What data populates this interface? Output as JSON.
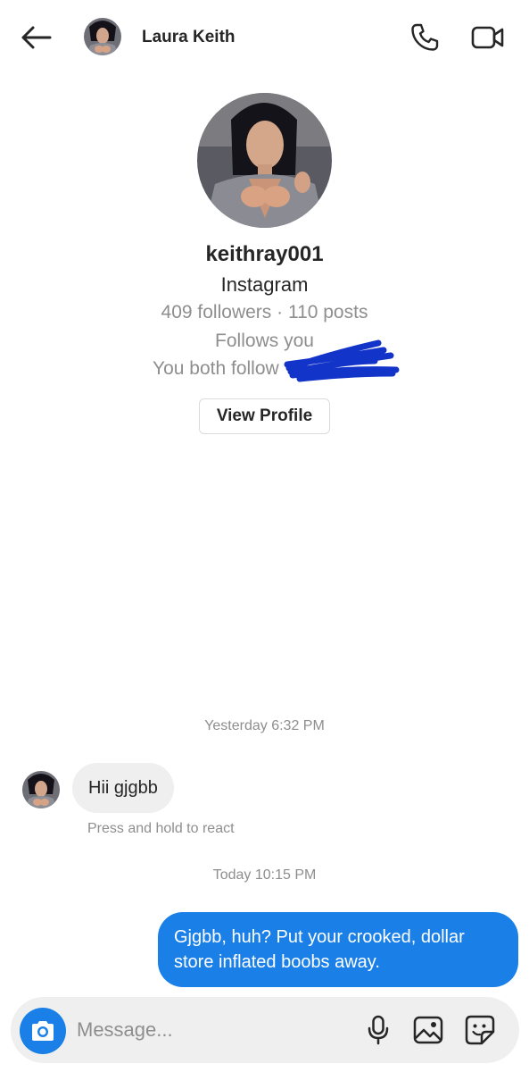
{
  "header": {
    "contact_name": "Laura Keith",
    "back_icon": "arrow-left-icon",
    "call_icon": "phone-icon",
    "video_icon": "video-camera-icon"
  },
  "profile": {
    "username": "keithray001",
    "platform": "Instagram",
    "stats": "409 followers · 110 posts",
    "follows_status": "Follows you",
    "mutual_prefix": "You both follow",
    "view_profile_label": "View Profile"
  },
  "messages": {
    "timestamp_1": "Yesterday 6:32 PM",
    "incoming_text": "Hii gjgbb",
    "react_hint": "Press and hold to react",
    "timestamp_2": "Today 10:15 PM",
    "outgoing_line_1": "Gjgbb, huh? Put your crooked, dollar",
    "outgoing_line_2": "store inflated boobs away."
  },
  "composer": {
    "placeholder": "Message...",
    "camera_icon": "camera-icon",
    "mic_icon": "microphone-icon",
    "gallery_icon": "image-gallery-icon",
    "sticker_icon": "sticker-icon"
  },
  "colors": {
    "accent_blue": "#1a80e8",
    "secondary_text": "#8e8e8e",
    "incoming_bubble": "#efefef",
    "redaction_marker": "#1234c8"
  }
}
